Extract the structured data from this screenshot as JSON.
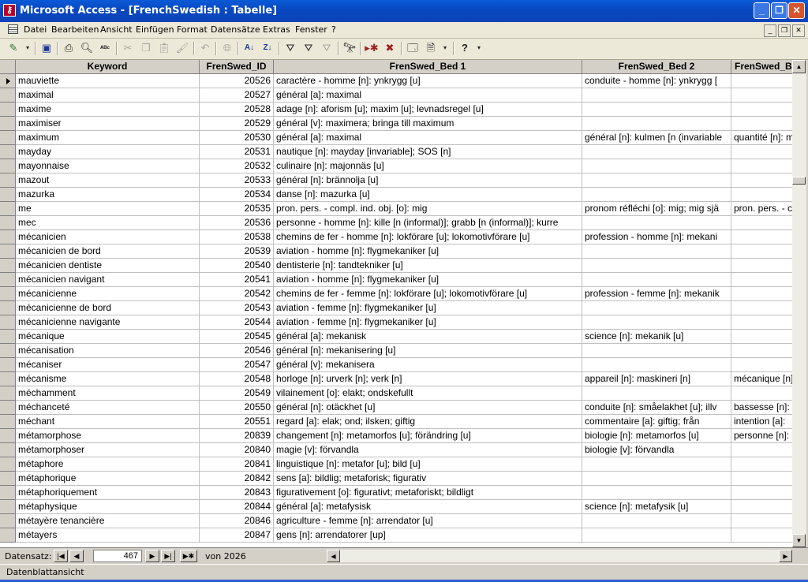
{
  "window": {
    "title": "Microsoft Access - [FrenchSwedish : Tabelle]",
    "app_icon": "access-key-icon",
    "buttons": {
      "minimize": "_",
      "restore": "❐",
      "close": "✕"
    }
  },
  "menu": {
    "items": [
      "Datei",
      "Bearbeiten",
      "Ansicht",
      "Einfügen",
      "Format",
      "Datensätze",
      "Extras",
      "Fenster",
      "?"
    ]
  },
  "toolbar": {
    "icons": [
      "view-icon",
      "save-icon",
      "print-icon",
      "print-preview-icon",
      "spelling-icon",
      "cut-icon",
      "copy-icon",
      "paste-icon",
      "format-painter-icon",
      "undo-icon",
      "hyperlink-icon",
      "sort-ascending-icon",
      "sort-descending-icon",
      "filter-by-selection-icon",
      "filter-by-form-icon",
      "apply-filter-icon",
      "find-icon",
      "new-record-icon",
      "delete-record-icon",
      "database-window-icon",
      "new-object-icon",
      "help-icon"
    ]
  },
  "table": {
    "columns": [
      "Keyword",
      "FrenSwed_ID",
      "FrenSwed_Bed 1",
      "FrenSwed_Bed 2",
      "FrenSwed_Bed 3"
    ],
    "rows": [
      [
        "mauviette",
        "20526",
        "caractère - homme [n]: ynkrygg [u]",
        "conduite - homme [n]: ynkrygg [",
        ""
      ],
      [
        "maximal",
        "20527",
        "général [a]: maximal",
        "",
        ""
      ],
      [
        "maxime",
        "20528",
        "adage [n]: aforism [u]; maxim [u]; levnadsregel [u]",
        "",
        ""
      ],
      [
        "maximiser",
        "20529",
        "général [v]: maximera; bringa till maximum",
        "",
        ""
      ],
      [
        "maximum",
        "20530",
        "général [a]: maximal",
        "général [n]: kulmen [n (invariable",
        "quantité [n]: m"
      ],
      [
        "mayday",
        "20531",
        "nautique [n]: mayday [invariable]; SOS [n]",
        "",
        ""
      ],
      [
        "mayonnaise",
        "20532",
        "culinaire [n]: majonnäs [u]",
        "",
        ""
      ],
      [
        "mazout",
        "20533",
        "général [n]: brännolja [u]",
        "",
        ""
      ],
      [
        "mazurka",
        "20534",
        "danse [n]: mazurka [u]",
        "",
        ""
      ],
      [
        "me",
        "20535",
        "pron. pers. - compl. ind. obj. [o]: mig",
        "pronom réfléchi [o]: mig; mig sjä",
        "pron. pers. - c"
      ],
      [
        "mec",
        "20536",
        "personne - homme [n]: kille [n (informal)]; grabb [n (informal)]; kurre",
        "",
        ""
      ],
      [
        "mécanicien",
        "20538",
        "chemins de fer - homme [n]: lokförare [u]; lokomotivförare [u]",
        "profession - homme [n]: mekani",
        ""
      ],
      [
        "mécanicien de bord",
        "20539",
        "aviation - homme [n]: flygmekaniker [u]",
        "",
        ""
      ],
      [
        "mécanicien dentiste",
        "20540",
        "dentisterie [n]: tandtekniker [u]",
        "",
        ""
      ],
      [
        "mécanicien navigant",
        "20541",
        "aviation - homme [n]: flygmekaniker [u]",
        "",
        ""
      ],
      [
        "mécanicienne",
        "20542",
        "chemins de fer - femme [n]: lokförare [u]; lokomotivförare [u]",
        "profession - femme [n]: mekanik",
        ""
      ],
      [
        "mécanicienne de bord",
        "20543",
        "aviation - femme [n]: flygmekaniker [u]",
        "",
        ""
      ],
      [
        "mécanicienne navigante",
        "20544",
        "aviation - femme [n]: flygmekaniker [u]",
        "",
        ""
      ],
      [
        "mécanique",
        "20545",
        "général [a]: mekanisk",
        "science [n]: mekanik [u]",
        ""
      ],
      [
        "mécanisation",
        "20546",
        "général [n]: mekanisering [u]",
        "",
        ""
      ],
      [
        "mécaniser",
        "20547",
        "général [v]: mekanisera",
        "",
        ""
      ],
      [
        "mécanisme",
        "20548",
        "horloge [n]: urverk [n]; verk [n]",
        "appareil [n]: maskineri [n]",
        "mécanique [n]"
      ],
      [
        "méchamment",
        "20549",
        "vilainement [o]: elakt; ondskefullt",
        "",
        ""
      ],
      [
        "méchanceté",
        "20550",
        "général [n]: otäckhet [u]",
        "conduite [n]: småelakhet [u]; illv",
        "bassesse [n]:"
      ],
      [
        "méchant",
        "20551",
        "regard [a]: elak; ond; ilsken; giftig",
        "commentaire [a]: giftig; från",
        "intention [a]:"
      ],
      [
        "métamorphose",
        "20839",
        "changement [n]: metamorfos [u]; förändring [u]",
        "biologie [n]: metamorfos [u]",
        "personne [n]:"
      ],
      [
        "métamorphoser",
        "20840",
        "magie [v]: förvandla",
        "biologie [v]: förvandla",
        ""
      ],
      [
        "métaphore",
        "20841",
        "linguistique [n]: metafor [u]; bild [u]",
        "",
        ""
      ],
      [
        "métaphorique",
        "20842",
        "sens [a]: bildlig; metaforisk; figurativ",
        "",
        ""
      ],
      [
        "métaphoriquement",
        "20843",
        "figurativement [o]: figurativt; metaforiskt; bildligt",
        "",
        ""
      ],
      [
        "métaphysique",
        "20844",
        "général [a]: metafysisk",
        "science [n]: metafysik [u]",
        ""
      ],
      [
        "métayère tenancière",
        "20846",
        "agriculture - femme [n]: arrendator [u]",
        "",
        ""
      ],
      [
        "métayers",
        "20847",
        "gens [n]: arrendatorer [up]",
        "",
        ""
      ]
    ]
  },
  "navigation": {
    "label": "Datensatz:",
    "current_record": "467",
    "of_label": "von",
    "total_records": "2026"
  },
  "status": {
    "text": "Datenblattansicht"
  }
}
